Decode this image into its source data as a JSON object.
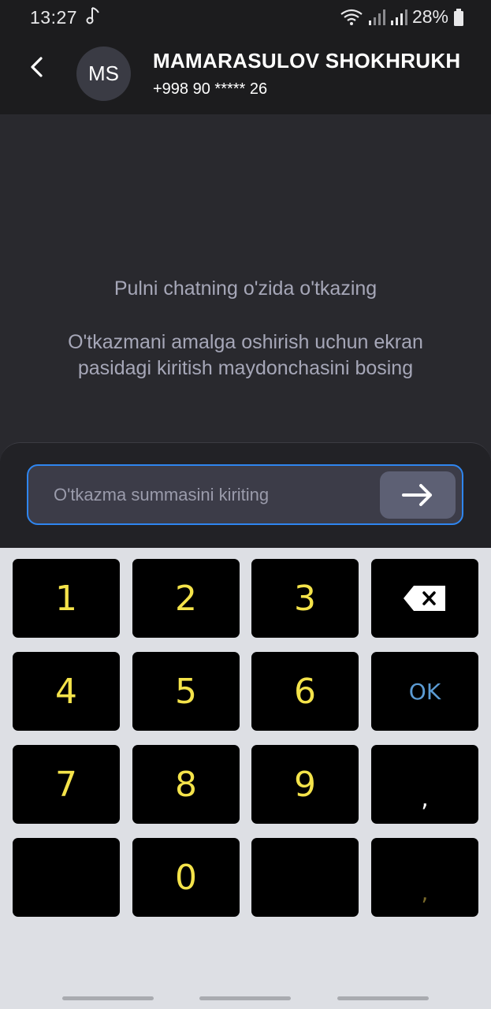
{
  "status_bar": {
    "time": "13:27",
    "battery_text": "28%",
    "icons": [
      "music-note-icon",
      "wifi-icon",
      "signal-icon",
      "signal-icon",
      "battery-icon"
    ]
  },
  "header": {
    "avatar_initials": "MS",
    "name": "MAMARASULOV SHOKHRUKH",
    "phone": "+998 90 ***** 26"
  },
  "chat": {
    "hint_title": "Pulni chatning o'zida o'tkazing",
    "hint_body": "O'tkazmani amalga oshirish uchun ekran pasidagi kiritish maydonchasini bosing"
  },
  "input": {
    "value": "",
    "placeholder": "O'tkazma summasini kiriting"
  },
  "keyboard": {
    "keys": [
      "1",
      "2",
      "3",
      "backspace",
      "4",
      "5",
      "6",
      "OK",
      "7",
      "8",
      "9",
      ",",
      "",
      "0",
      "",
      ","
    ],
    "ok_label": "OK",
    "comma_label": ","
  },
  "colors": {
    "accent": "#2f86f0",
    "digit": "#f4e34a",
    "ok": "#5b9bd3"
  }
}
